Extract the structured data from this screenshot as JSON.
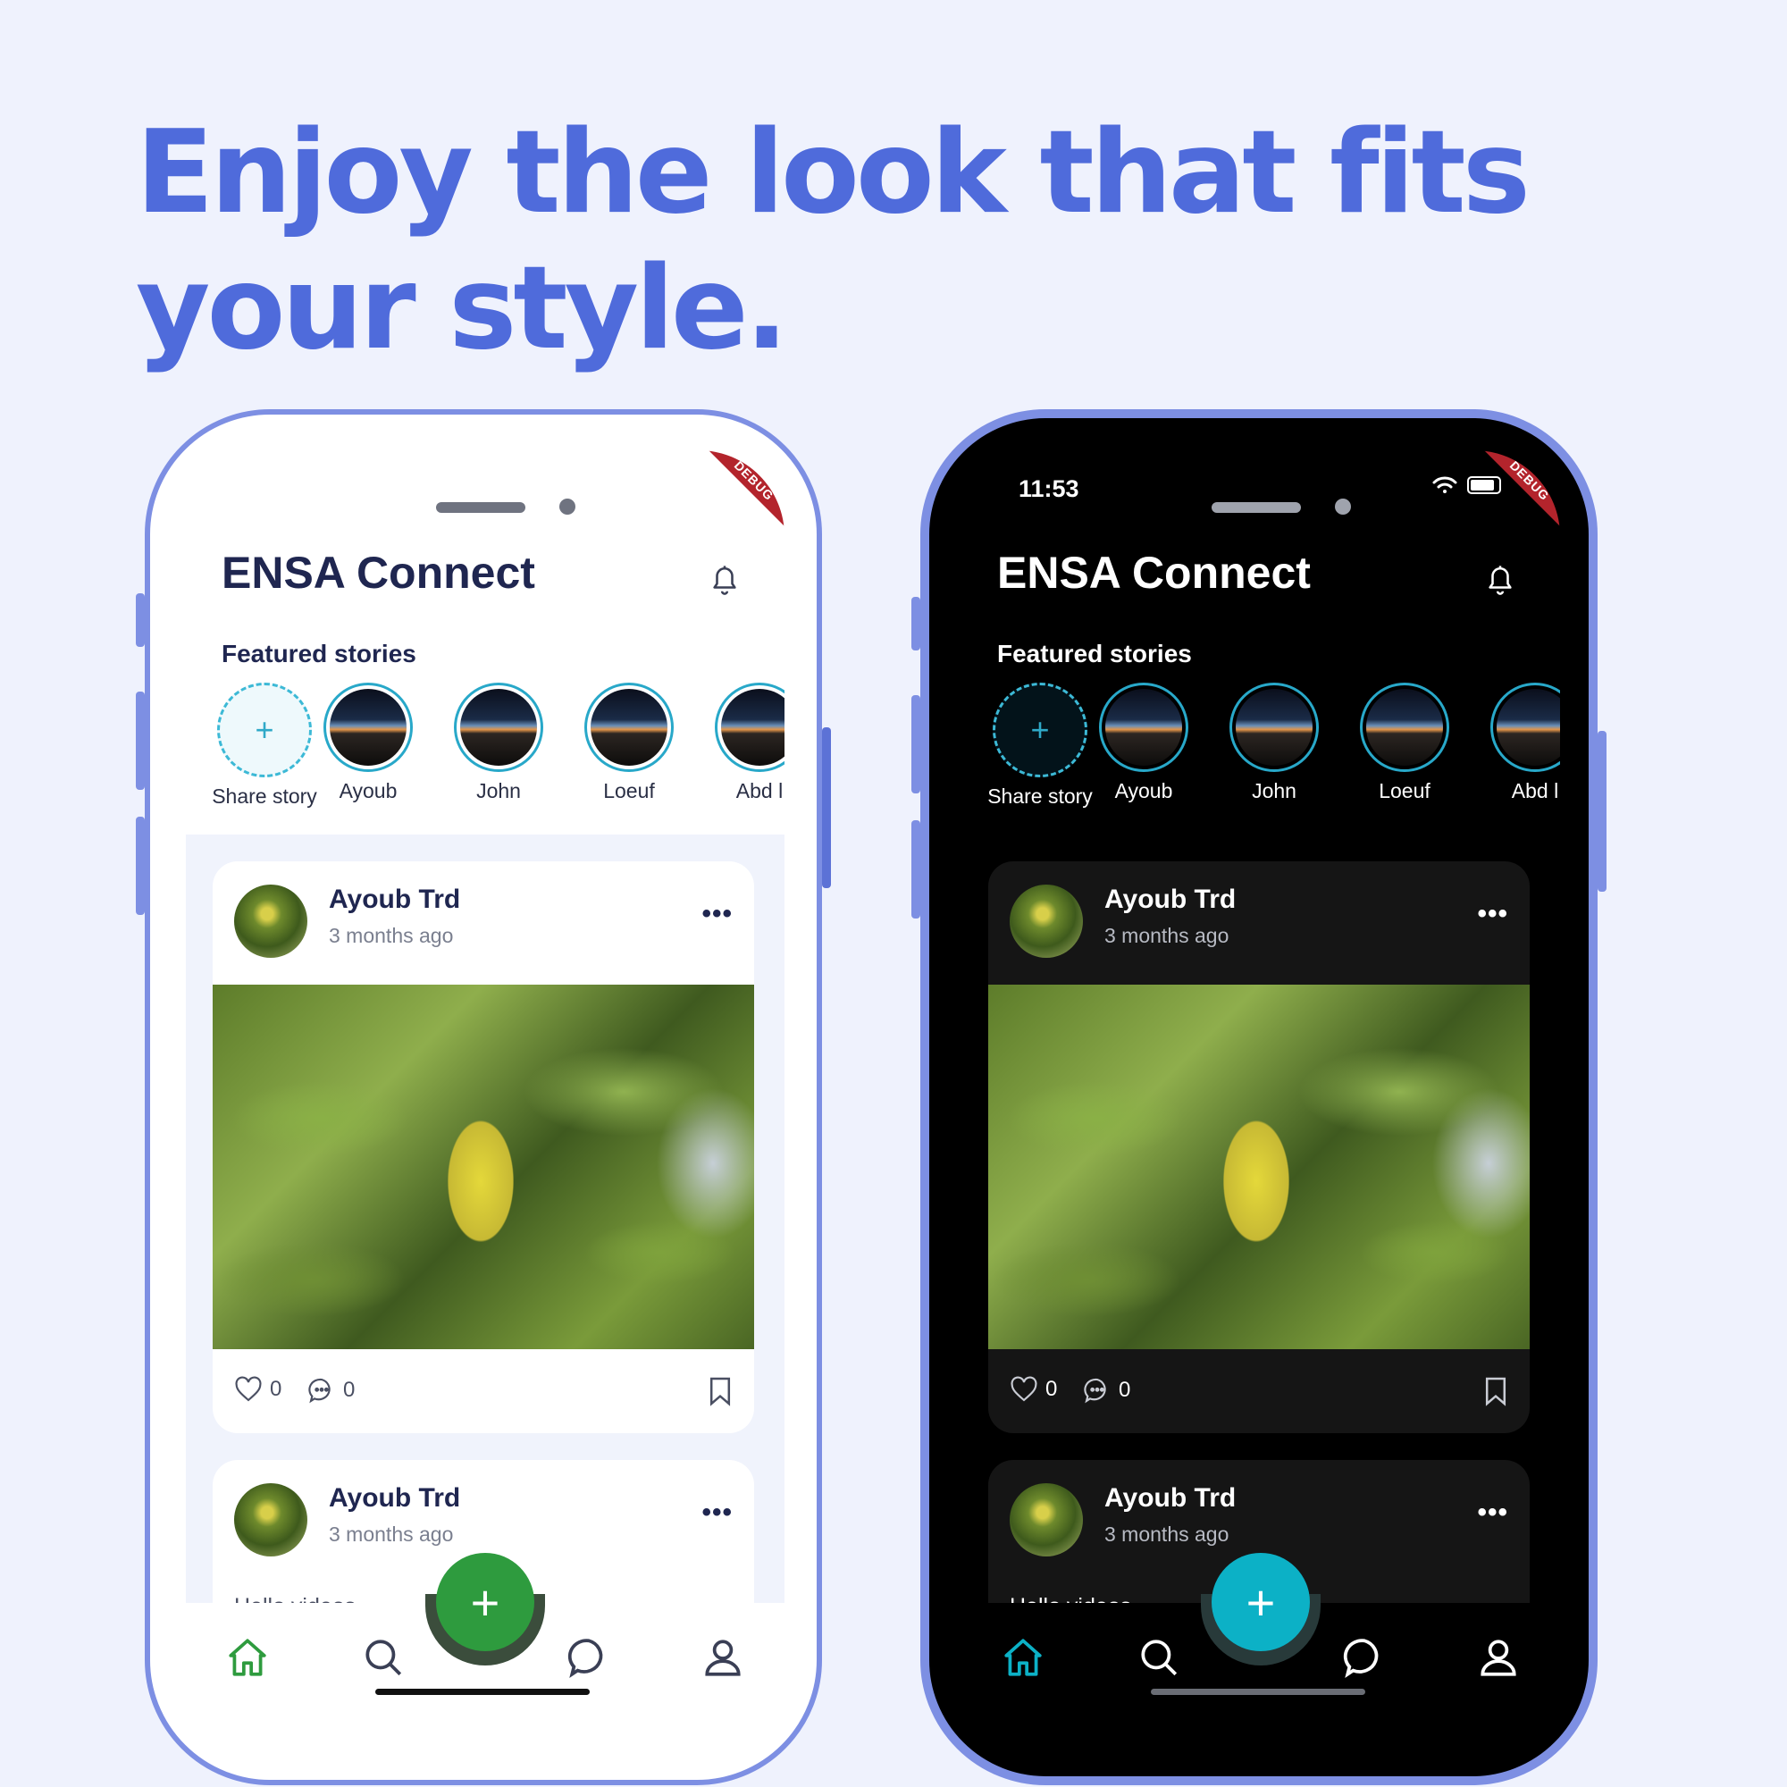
{
  "headline": {
    "line1": "Enjoy the look that fits",
    "line2": "your style."
  },
  "colors": {
    "headline": "#4f6bdb",
    "frame": "#7d8fe3",
    "light_fab": "#2e9b3e",
    "dark_fab": "#0cb1c6",
    "light_home_active": "#2e9b3e",
    "dark_home_active": "#0cb1c6",
    "story_ring": "#28a8c9",
    "debug_banner": "#b3242c"
  },
  "light_phone": {
    "debug_label": "DEBUG",
    "app_title": "ENSA Connect",
    "bell_icon": "bell-icon",
    "featured_title": "Featured stories",
    "stories": [
      "Share story",
      "Ayoub",
      "John",
      "Loeuf",
      "Abd l"
    ],
    "posts": [
      {
        "author": "Ayoub Trd",
        "time": "3 months ago",
        "likes": "0",
        "comments": "0"
      },
      {
        "author": "Ayoub Trd",
        "time": "3 months ago",
        "text": "Hello videos"
      }
    ],
    "nav": [
      "home-icon",
      "search-icon",
      "add-icon",
      "chat-icon",
      "profile-icon"
    ]
  },
  "dark_phone": {
    "status_time": "11:53",
    "debug_label": "DEBUG",
    "app_title": "ENSA Connect",
    "bell_icon": "bell-icon",
    "featured_title": "Featured stories",
    "stories": [
      "Share story",
      "Ayoub",
      "John",
      "Loeuf",
      "Abd l"
    ],
    "posts": [
      {
        "author": "Ayoub Trd",
        "time": "3 months ago",
        "likes": "0",
        "comments": "0"
      },
      {
        "author": "Ayoub Trd",
        "time": "3 months ago",
        "text": "Hello videos"
      }
    ],
    "nav": [
      "home-icon",
      "search-icon",
      "add-icon",
      "chat-icon",
      "profile-icon"
    ]
  }
}
